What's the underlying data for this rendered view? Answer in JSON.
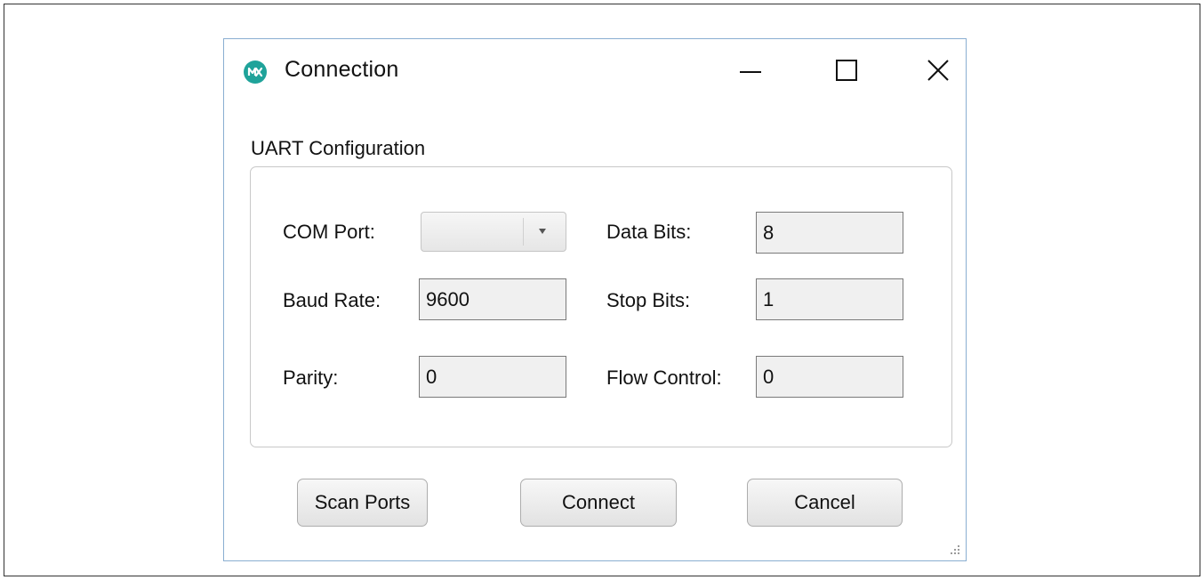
{
  "window": {
    "title": "Connection",
    "icon": "maxim-logo-icon"
  },
  "group": {
    "label": "UART Configuration"
  },
  "fields": {
    "com_port": {
      "label": "COM Port:",
      "value": ""
    },
    "baud_rate": {
      "label": "Baud Rate:",
      "value": "9600"
    },
    "parity": {
      "label": "Parity:",
      "value": "0"
    },
    "data_bits": {
      "label": "Data Bits:",
      "value": "8"
    },
    "stop_bits": {
      "label": "Stop Bits:",
      "value": "1"
    },
    "flow_control": {
      "label": "Flow Control:",
      "value": "0"
    }
  },
  "buttons": {
    "scan_ports": "Scan Ports",
    "connect": "Connect",
    "cancel": "Cancel"
  },
  "colors": {
    "accent_border": "#8aaed1",
    "icon_teal": "#1fa39a"
  }
}
